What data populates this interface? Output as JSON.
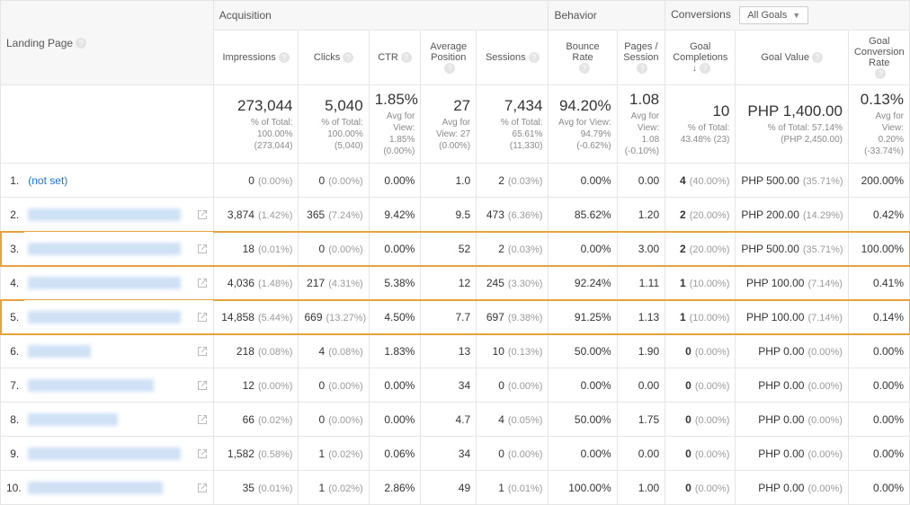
{
  "headers": {
    "landing_page": "Landing Page",
    "groups": {
      "acquisition": "Acquisition",
      "behavior": "Behavior",
      "conversions": "Conversions"
    },
    "conversions_picker": "All Goals",
    "cols": {
      "impressions": "Impressions",
      "clicks": "Clicks",
      "ctr": "CTR",
      "avg_position": "Average Position",
      "sessions": "Sessions",
      "bounce_rate": "Bounce Rate",
      "pages_per_session": "Pages / Session",
      "goal_completions": "Goal Completions",
      "goal_value": "Goal Value",
      "goal_conv_rate": "Goal Conversion Rate"
    }
  },
  "summary": {
    "impressions": {
      "big": "273,044",
      "sub1": "% of Total:",
      "sub2": "100.00%",
      "sub3": "(273,044)"
    },
    "clicks": {
      "big": "5,040",
      "sub1": "% of Total:",
      "sub2": "100.00%",
      "sub3": "(5,040)"
    },
    "ctr": {
      "big": "1.85%",
      "sub1": "Avg for",
      "sub2": "View:",
      "sub3": "1.85%",
      "sub4": "(0.00%)"
    },
    "avg_position": {
      "big": "27",
      "sub1": "Avg for",
      "sub2": "View: 27",
      "sub3": "(0.00%)"
    },
    "sessions": {
      "big": "7,434",
      "sub1": "% of Total:",
      "sub2": "65.61%",
      "sub3": "(11,330)"
    },
    "bounce_rate": {
      "big": "94.20%",
      "sub1": "Avg for View:",
      "sub2": "94.79%",
      "sub3": "(-0.62%)"
    },
    "pages_per_session": {
      "big": "1.08",
      "sub1": "Avg for",
      "sub2": "View:",
      "sub3": "1.08",
      "sub4": "(-0.10%)"
    },
    "goal_completions": {
      "big": "10",
      "sub1": "% of Total:",
      "sub2": "43.48% (23)"
    },
    "goal_value": {
      "big": "PHP 1,400.00",
      "sub1": "% of Total: 57.14%",
      "sub2": "(PHP 2,450.00)"
    },
    "goal_conv_rate": {
      "big": "0.13%",
      "sub1": "Avg for",
      "sub2": "View:",
      "sub3": "0.20%",
      "sub4": "(-33.74%)"
    }
  },
  "rows": [
    {
      "idx": "1.",
      "page_text": "(not set)",
      "page_link": true,
      "blur_w": 0,
      "impressions": "0",
      "impressions_pct": "(0.00%)",
      "clicks": "0",
      "clicks_pct": "(0.00%)",
      "ctr": "0.00%",
      "avg_position": "1.0",
      "sessions": "2",
      "sessions_pct": "(0.03%)",
      "bounce_rate": "0.00%",
      "pps": "0.00",
      "gc": "4",
      "gc_pct": "(40.00%)",
      "gv": "PHP 500.00",
      "gv_pct": "(35.71%)",
      "gcr": "200.00%",
      "hl": false,
      "ext": false
    },
    {
      "idx": "2.",
      "page_text": "",
      "page_link": false,
      "blur_w": 170,
      "impressions": "3,874",
      "impressions_pct": "(1.42%)",
      "clicks": "365",
      "clicks_pct": "(7.24%)",
      "ctr": "9.42%",
      "avg_position": "9.5",
      "sessions": "473",
      "sessions_pct": "(6.36%)",
      "bounce_rate": "85.62%",
      "pps": "1.20",
      "gc": "2",
      "gc_pct": "(20.00%)",
      "gv": "PHP 200.00",
      "gv_pct": "(14.29%)",
      "gcr": "0.42%",
      "hl": false,
      "ext": true
    },
    {
      "idx": "3.",
      "page_text": "",
      "page_link": false,
      "blur_w": 170,
      "impressions": "18",
      "impressions_pct": "(0.01%)",
      "clicks": "0",
      "clicks_pct": "(0.00%)",
      "ctr": "0.00%",
      "avg_position": "52",
      "sessions": "2",
      "sessions_pct": "(0.03%)",
      "bounce_rate": "0.00%",
      "pps": "3.00",
      "gc": "2",
      "gc_pct": "(20.00%)",
      "gv": "PHP 500.00",
      "gv_pct": "(35.71%)",
      "gcr": "100.00%",
      "hl": true,
      "ext": true
    },
    {
      "idx": "4.",
      "page_text": "",
      "page_link": false,
      "blur_w": 170,
      "impressions": "4,036",
      "impressions_pct": "(1.48%)",
      "clicks": "217",
      "clicks_pct": "(4.31%)",
      "ctr": "5.38%",
      "avg_position": "12",
      "sessions": "245",
      "sessions_pct": "(3.30%)",
      "bounce_rate": "92.24%",
      "pps": "1.11",
      "gc": "1",
      "gc_pct": "(10.00%)",
      "gv": "PHP 100.00",
      "gv_pct": "(7.14%)",
      "gcr": "0.41%",
      "hl": false,
      "ext": true
    },
    {
      "idx": "5.",
      "page_text": "",
      "page_link": false,
      "blur_w": 170,
      "impressions": "14,858",
      "impressions_pct": "(5.44%)",
      "clicks": "669",
      "clicks_pct": "(13.27%)",
      "ctr": "4.50%",
      "avg_position": "7.7",
      "sessions": "697",
      "sessions_pct": "(9.38%)",
      "bounce_rate": "91.25%",
      "pps": "1.13",
      "gc": "1",
      "gc_pct": "(10.00%)",
      "gv": "PHP 100.00",
      "gv_pct": "(7.14%)",
      "gcr": "0.14%",
      "hl": true,
      "ext": true
    },
    {
      "idx": "6.",
      "page_text": "",
      "page_link": false,
      "blur_w": 70,
      "impressions": "218",
      "impressions_pct": "(0.08%)",
      "clicks": "4",
      "clicks_pct": "(0.08%)",
      "ctr": "1.83%",
      "avg_position": "13",
      "sessions": "10",
      "sessions_pct": "(0.13%)",
      "bounce_rate": "50.00%",
      "pps": "1.90",
      "gc": "0",
      "gc_pct": "(0.00%)",
      "gv": "PHP 0.00",
      "gv_pct": "(0.00%)",
      "gcr": "0.00%",
      "hl": false,
      "ext": true
    },
    {
      "idx": "7.",
      "page_text": "",
      "page_link": false,
      "blur_w": 140,
      "impressions": "12",
      "impressions_pct": "(0.00%)",
      "clicks": "0",
      "clicks_pct": "(0.00%)",
      "ctr": "0.00%",
      "avg_position": "34",
      "sessions": "0",
      "sessions_pct": "(0.00%)",
      "bounce_rate": "0.00%",
      "pps": "0.00",
      "gc": "0",
      "gc_pct": "(0.00%)",
      "gv": "PHP 0.00",
      "gv_pct": "(0.00%)",
      "gcr": "0.00%",
      "hl": false,
      "ext": true
    },
    {
      "idx": "8.",
      "page_text": "",
      "page_link": false,
      "blur_w": 100,
      "impressions": "66",
      "impressions_pct": "(0.02%)",
      "clicks": "0",
      "clicks_pct": "(0.00%)",
      "ctr": "0.00%",
      "avg_position": "4.7",
      "sessions": "4",
      "sessions_pct": "(0.05%)",
      "bounce_rate": "50.00%",
      "pps": "1.75",
      "gc": "0",
      "gc_pct": "(0.00%)",
      "gv": "PHP 0.00",
      "gv_pct": "(0.00%)",
      "gcr": "0.00%",
      "hl": false,
      "ext": true
    },
    {
      "idx": "9.",
      "page_text": "",
      "page_link": false,
      "blur_w": 170,
      "impressions": "1,582",
      "impressions_pct": "(0.58%)",
      "clicks": "1",
      "clicks_pct": "(0.02%)",
      "ctr": "0.06%",
      "avg_position": "34",
      "sessions": "0",
      "sessions_pct": "(0.00%)",
      "bounce_rate": "0.00%",
      "pps": "0.00",
      "gc": "0",
      "gc_pct": "(0.00%)",
      "gv": "PHP 0.00",
      "gv_pct": "(0.00%)",
      "gcr": "0.00%",
      "hl": false,
      "ext": true
    },
    {
      "idx": "10.",
      "page_text": "",
      "page_link": false,
      "blur_w": 150,
      "impressions": "35",
      "impressions_pct": "(0.01%)",
      "clicks": "1",
      "clicks_pct": "(0.02%)",
      "ctr": "2.86%",
      "avg_position": "49",
      "sessions": "1",
      "sessions_pct": "(0.01%)",
      "bounce_rate": "100.00%",
      "pps": "1.00",
      "gc": "0",
      "gc_pct": "(0.00%)",
      "gv": "PHP 0.00",
      "gv_pct": "(0.00%)",
      "gcr": "0.00%",
      "hl": false,
      "ext": true
    }
  ]
}
